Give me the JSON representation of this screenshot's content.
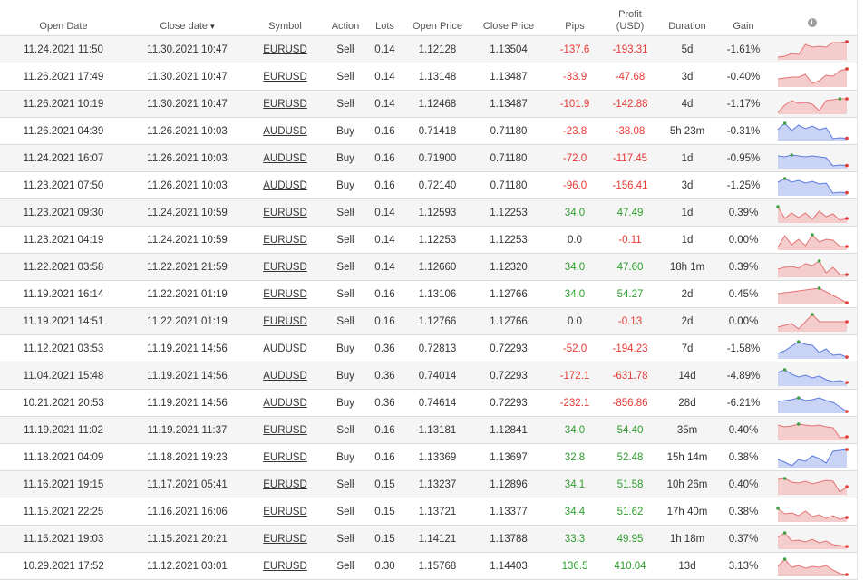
{
  "colors": {
    "negative": "#e53935",
    "positive": "#2e9e2e",
    "sell_fill": "#f4cccc",
    "sell_line": "#e57373",
    "buy_fill": "#c9d3f5",
    "buy_line": "#5c7be0",
    "dot_start": "#43a047",
    "dot_end": "#e53935"
  },
  "columns": {
    "open_date": "Open Date",
    "close_date": "Close date",
    "sort_arrow": "▾",
    "symbol": "Symbol",
    "action": "Action",
    "lots": "Lots",
    "open_price": "Open Price",
    "close_price": "Close Price",
    "pips": "Pips",
    "profit_line1": "Profit",
    "profit_line2": "(USD)",
    "duration": "Duration",
    "gain": "Gain",
    "info_icon": "i"
  },
  "trades": [
    {
      "open_date": "11.24.2021 11:50",
      "close_date": "11.30.2021 10:47",
      "symbol": "EURUSD",
      "action": "Sell",
      "lots": "0.14",
      "open_price": "1.12128",
      "close_price": "1.13504",
      "pips": "-137.6",
      "profit": "-193.31",
      "duration": "5d",
      "gain": "-1.61%",
      "sign": "neg",
      "spark": [
        0.9,
        0.85,
        0.7,
        0.75,
        0.2,
        0.35,
        0.3,
        0.35,
        0.1,
        0.1,
        0.05
      ]
    },
    {
      "open_date": "11.26.2021 17:49",
      "close_date": "11.30.2021 10:47",
      "symbol": "EURUSD",
      "action": "Sell",
      "lots": "0.14",
      "open_price": "1.13148",
      "close_price": "1.13487",
      "pips": "-33.9",
      "profit": "-47.68",
      "duration": "3d",
      "gain": "-0.40%",
      "sign": "neg",
      "spark": [
        0.6,
        0.55,
        0.5,
        0.5,
        0.35,
        0.85,
        0.7,
        0.4,
        0.45,
        0.15,
        0.05
      ]
    },
    {
      "open_date": "11.26.2021 10:19",
      "close_date": "11.30.2021 10:47",
      "symbol": "EURUSD",
      "action": "Sell",
      "lots": "0.14",
      "open_price": "1.12468",
      "close_price": "1.13487",
      "pips": "-101.9",
      "profit": "-142.88",
      "duration": "4d",
      "gain": "-1.17%",
      "sign": "neg",
      "spark": [
        0.95,
        0.55,
        0.3,
        0.45,
        0.4,
        0.5,
        0.85,
        0.3,
        0.25,
        0.2,
        0.2
      ]
    },
    {
      "open_date": "11.26.2021 04:39",
      "close_date": "11.26.2021 10:03",
      "symbol": "AUDUSD",
      "action": "Buy",
      "lots": "0.16",
      "open_price": "0.71418",
      "close_price": "0.71180",
      "pips": "-23.8",
      "profit": "-38.08",
      "duration": "5h 23m",
      "gain": "-0.31%",
      "sign": "neg",
      "spark": [
        0.4,
        0.05,
        0.45,
        0.15,
        0.35,
        0.2,
        0.4,
        0.3,
        0.9,
        0.85,
        0.88
      ]
    },
    {
      "open_date": "11.24.2021 16:07",
      "close_date": "11.26.2021 10:03",
      "symbol": "AUDUSD",
      "action": "Buy",
      "lots": "0.16",
      "open_price": "0.71900",
      "close_price": "0.71180",
      "pips": "-72.0",
      "profit": "-117.45",
      "duration": "1d",
      "gain": "-0.95%",
      "sign": "neg",
      "spark": [
        0.35,
        0.4,
        0.3,
        0.35,
        0.4,
        0.35,
        0.4,
        0.45,
        0.9,
        0.85,
        0.88
      ]
    },
    {
      "open_date": "11.23.2021 07:50",
      "close_date": "11.26.2021 10:03",
      "symbol": "AUDUSD",
      "action": "Buy",
      "lots": "0.16",
      "open_price": "0.72140",
      "close_price": "0.71180",
      "pips": "-96.0",
      "profit": "-156.41",
      "duration": "3d",
      "gain": "-1.25%",
      "sign": "neg",
      "spark": [
        0.3,
        0.1,
        0.3,
        0.2,
        0.35,
        0.25,
        0.4,
        0.35,
        0.9,
        0.85,
        0.88
      ]
    },
    {
      "open_date": "11.23.2021 09:30",
      "close_date": "11.24.2021 10:59",
      "symbol": "EURUSD",
      "action": "Sell",
      "lots": "0.14",
      "open_price": "1.12593",
      "close_price": "1.12253",
      "pips": "34.0",
      "profit": "47.49",
      "duration": "1d",
      "gain": "0.39%",
      "sign": "pos",
      "spark": [
        0.15,
        0.8,
        0.5,
        0.75,
        0.5,
        0.85,
        0.4,
        0.7,
        0.55,
        0.9,
        0.8
      ]
    },
    {
      "open_date": "11.23.2021 04:19",
      "close_date": "11.24.2021 10:59",
      "symbol": "EURUSD",
      "action": "Sell",
      "lots": "0.14",
      "open_price": "1.12253",
      "close_price": "1.12253",
      "pips": "0.0",
      "profit": "-0.11",
      "duration": "1d",
      "gain": "0.00%",
      "sign": "zero",
      "spark": [
        0.9,
        0.25,
        0.75,
        0.45,
        0.8,
        0.2,
        0.6,
        0.45,
        0.5,
        0.85,
        0.85
      ]
    },
    {
      "open_date": "11.22.2021 03:58",
      "close_date": "11.22.2021 21:59",
      "symbol": "EURUSD",
      "action": "Sell",
      "lots": "0.14",
      "open_price": "1.12660",
      "close_price": "1.12320",
      "pips": "34.0",
      "profit": "47.60",
      "duration": "18h 1m",
      "gain": "0.39%",
      "sign": "pos",
      "spark": [
        0.6,
        0.5,
        0.45,
        0.55,
        0.3,
        0.4,
        0.15,
        0.8,
        0.5,
        0.9,
        0.9
      ]
    },
    {
      "open_date": "11.19.2021 16:14",
      "close_date": "11.22.2021 01:19",
      "symbol": "EURUSD",
      "action": "Sell",
      "lots": "0.16",
      "open_price": "1.13106",
      "close_price": "1.12766",
      "pips": "34.0",
      "profit": "54.27",
      "duration": "2d",
      "gain": "0.45%",
      "sign": "pos",
      "spark": [
        0.45,
        0.4,
        0.35,
        0.3,
        0.25,
        0.2,
        0.15,
        0.35,
        0.55,
        0.75,
        0.95
      ]
    },
    {
      "open_date": "11.19.2021 14:51",
      "close_date": "11.22.2021 01:19",
      "symbol": "EURUSD",
      "action": "Sell",
      "lots": "0.16",
      "open_price": "1.12766",
      "close_price": "1.12766",
      "pips": "0.0",
      "profit": "-0.13",
      "duration": "2d",
      "gain": "0.00%",
      "sign": "zero",
      "spark": [
        0.8,
        0.7,
        0.6,
        0.9,
        0.5,
        0.1,
        0.5,
        0.5,
        0.5,
        0.5,
        0.5
      ]
    },
    {
      "open_date": "11.12.2021 03:53",
      "close_date": "11.19.2021 14:56",
      "symbol": "AUDUSD",
      "action": "Buy",
      "lots": "0.36",
      "open_price": "0.72813",
      "close_price": "0.72293",
      "pips": "-52.0",
      "profit": "-194.23",
      "duration": "7d",
      "gain": "-1.58%",
      "sign": "neg",
      "spark": [
        0.75,
        0.6,
        0.35,
        0.1,
        0.25,
        0.3,
        0.7,
        0.5,
        0.85,
        0.8,
        0.95
      ]
    },
    {
      "open_date": "11.04.2021 15:48",
      "close_date": "11.19.2021 14:56",
      "symbol": "AUDUSD",
      "action": "Buy",
      "lots": "0.36",
      "open_price": "0.74014",
      "close_price": "0.72293",
      "pips": "-172.1",
      "profit": "-631.78",
      "duration": "14d",
      "gain": "-4.89%",
      "sign": "neg",
      "spark": [
        0.3,
        0.15,
        0.4,
        0.55,
        0.45,
        0.6,
        0.5,
        0.7,
        0.8,
        0.75,
        0.85
      ]
    },
    {
      "open_date": "10.21.2021 20:53",
      "close_date": "11.19.2021 14:56",
      "symbol": "AUDUSD",
      "action": "Buy",
      "lots": "0.36",
      "open_price": "0.74614",
      "close_price": "0.72293",
      "pips": "-232.1",
      "profit": "-856.86",
      "duration": "28d",
      "gain": "-6.21%",
      "sign": "neg",
      "spark": [
        0.4,
        0.35,
        0.3,
        0.2,
        0.35,
        0.3,
        0.2,
        0.35,
        0.45,
        0.7,
        0.95
      ]
    },
    {
      "open_date": "11.19.2021 11:02",
      "close_date": "11.19.2021 11:37",
      "symbol": "EURUSD",
      "action": "Sell",
      "lots": "0.16",
      "open_price": "1.13181",
      "close_price": "1.12841",
      "pips": "34.0",
      "profit": "54.40",
      "duration": "35m",
      "gain": "0.40%",
      "sign": "pos",
      "spark": [
        0.2,
        0.3,
        0.25,
        0.15,
        0.2,
        0.25,
        0.2,
        0.3,
        0.35,
        0.9,
        0.85
      ]
    },
    {
      "open_date": "11.18.2021 04:09",
      "close_date": "11.18.2021 19:23",
      "symbol": "EURUSD",
      "action": "Buy",
      "lots": "0.16",
      "open_price": "1.13369",
      "close_price": "1.13697",
      "pips": "32.8",
      "profit": "52.48",
      "duration": "15h 14m",
      "gain": "0.38%",
      "sign": "pos",
      "spark": [
        0.6,
        0.75,
        0.95,
        0.6,
        0.7,
        0.4,
        0.55,
        0.8,
        0.15,
        0.1,
        0.05
      ]
    },
    {
      "open_date": "11.16.2021 19:15",
      "close_date": "11.17.2021 05:41",
      "symbol": "EURUSD",
      "action": "Sell",
      "lots": "0.15",
      "open_price": "1.13237",
      "close_price": "1.12896",
      "pips": "34.1",
      "profit": "51.58",
      "duration": "10h 26m",
      "gain": "0.40%",
      "sign": "pos",
      "spark": [
        0.2,
        0.15,
        0.35,
        0.4,
        0.3,
        0.45,
        0.35,
        0.25,
        0.3,
        0.9,
        0.6
      ]
    },
    {
      "open_date": "11.15.2021 22:25",
      "close_date": "11.16.2021 16:06",
      "symbol": "EURUSD",
      "action": "Sell",
      "lots": "0.15",
      "open_price": "1.13721",
      "close_price": "1.13377",
      "pips": "34.4",
      "profit": "51.62",
      "duration": "17h 40m",
      "gain": "0.38%",
      "sign": "pos",
      "spark": [
        0.3,
        0.6,
        0.55,
        0.7,
        0.45,
        0.75,
        0.65,
        0.85,
        0.7,
        0.9,
        0.8
      ]
    },
    {
      "open_date": "11.15.2021 19:03",
      "close_date": "11.15.2021 20:21",
      "symbol": "EURUSD",
      "action": "Sell",
      "lots": "0.15",
      "open_price": "1.14121",
      "close_price": "1.13788",
      "pips": "33.3",
      "profit": "49.95",
      "duration": "1h 18m",
      "gain": "0.37%",
      "sign": "pos",
      "spark": [
        0.4,
        0.15,
        0.6,
        0.55,
        0.65,
        0.5,
        0.7,
        0.6,
        0.8,
        0.85,
        0.9
      ]
    },
    {
      "open_date": "10.29.2021 17:52",
      "close_date": "11.12.2021 03:01",
      "symbol": "EURUSD",
      "action": "Sell",
      "lots": "0.30",
      "open_price": "1.15768",
      "close_price": "1.14403",
      "pips": "136.5",
      "profit": "410.04",
      "duration": "13d",
      "gain": "3.13%",
      "sign": "pos",
      "spark": [
        0.5,
        0.1,
        0.55,
        0.45,
        0.6,
        0.5,
        0.55,
        0.45,
        0.7,
        0.9,
        0.95
      ]
    }
  ]
}
